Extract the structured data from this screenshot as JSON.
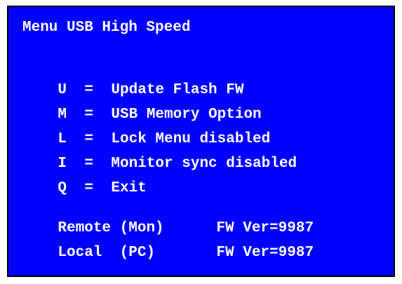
{
  "colors": {
    "screen_background": "#0000ff",
    "text": "#ffffff",
    "border": "#000000"
  },
  "menu": {
    "title": "Menu USB High Speed",
    "items": [
      {
        "key": "U",
        "sep": "=",
        "label": "Update Flash FW"
      },
      {
        "key": "M",
        "sep": "=",
        "label": "USB Memory Option"
      },
      {
        "key": "L",
        "sep": "=",
        "label": "Lock Menu disabled"
      },
      {
        "key": "I",
        "sep": "=",
        "label": "Monitor sync disabled"
      },
      {
        "key": "Q",
        "sep": "=",
        "label": "Exit"
      }
    ]
  },
  "firmware": {
    "remote": {
      "device": "Remote (Mon)",
      "version": "FW Ver=9987"
    },
    "local": {
      "device": "Local  (PC)",
      "version": "FW Ver=9987"
    }
  }
}
